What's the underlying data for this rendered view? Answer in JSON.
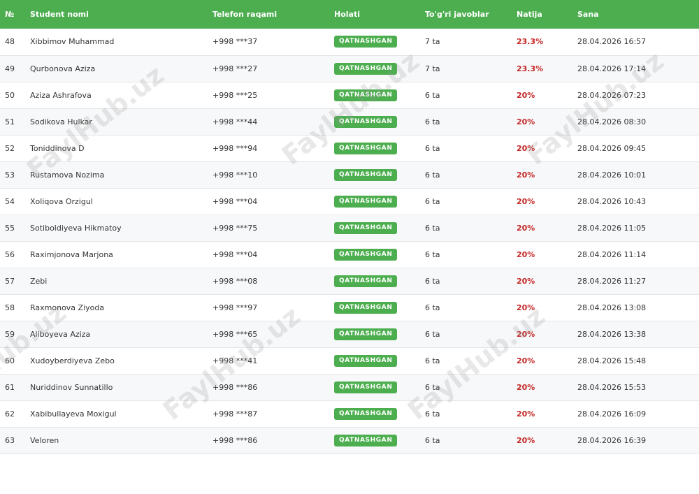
{
  "table": {
    "columns": [
      "№",
      "Student nomi",
      "Telefon raqami",
      "Holati",
      "To'g'ri javoblar",
      "Natija",
      "Sana"
    ],
    "rows": [
      {
        "num": "48",
        "name": "Xibbimov Muhammad",
        "phone": "+998 ***37",
        "status": "QATNASHGAN",
        "correct": "7 ta",
        "result": "23.3%",
        "date": "28.04.2026 16:57"
      },
      {
        "num": "49",
        "name": "Qurbonova Aziza",
        "phone": "+998 ***27",
        "status": "QATNASHGAN",
        "correct": "7 ta",
        "result": "23.3%",
        "date": "28.04.2026 17:14"
      },
      {
        "num": "50",
        "name": "Aziza Ashrafova",
        "phone": "+998 ***25",
        "status": "QATNASHGAN",
        "correct": "6 ta",
        "result": "20%",
        "date": "28.04.2026 07:23"
      },
      {
        "num": "51",
        "name": "Sodikova Hulkar",
        "phone": "+998 ***44",
        "status": "QATNASHGAN",
        "correct": "6 ta",
        "result": "20%",
        "date": "28.04.2026 08:30"
      },
      {
        "num": "52",
        "name": "Toniddinova D",
        "phone": "+998 ***94",
        "status": "QATNASHGAN",
        "correct": "6 ta",
        "result": "20%",
        "date": "28.04.2026 09:45"
      },
      {
        "num": "53",
        "name": "Rustamova Nozima",
        "phone": "+998 ***10",
        "status": "QATNASHGAN",
        "correct": "6 ta",
        "result": "20%",
        "date": "28.04.2026 10:01"
      },
      {
        "num": "54",
        "name": "Xoliqova Orzigul",
        "phone": "+998 ***04",
        "status": "QATNASHGAN",
        "correct": "6 ta",
        "result": "20%",
        "date": "28.04.2026 10:43"
      },
      {
        "num": "55",
        "name": "Sotiboldiyeva Hikmatoy",
        "phone": "+998 ***75",
        "status": "QATNASHGAN",
        "correct": "6 ta",
        "result": "20%",
        "date": "28.04.2026 11:05"
      },
      {
        "num": "56",
        "name": "Raximjonova Marjona",
        "phone": "+998 ***04",
        "status": "QATNASHGAN",
        "correct": "6 ta",
        "result": "20%",
        "date": "28.04.2026 11:14"
      },
      {
        "num": "57",
        "name": "Zebi",
        "phone": "+998 ***08",
        "status": "QATNASHGAN",
        "correct": "6 ta",
        "result": "20%",
        "date": "28.04.2026 11:27"
      },
      {
        "num": "58",
        "name": "Raxmonova Ziyoda",
        "phone": "+998 ***97",
        "status": "QATNASHGAN",
        "correct": "6 ta",
        "result": "20%",
        "date": "28.04.2026 13:08"
      },
      {
        "num": "59",
        "name": "Aliboyeva Aziza",
        "phone": "+998 ***65",
        "status": "QATNASHGAN",
        "correct": "6 ta",
        "result": "20%",
        "date": "28.04.2026 13:38"
      },
      {
        "num": "60",
        "name": "Xudoyberdiyeva Zebo",
        "phone": "+998 ***41",
        "status": "QATNASHGAN",
        "correct": "6 ta",
        "result": "20%",
        "date": "28.04.2026 15:48"
      },
      {
        "num": "61",
        "name": "Nuriddinov Sunnatillo",
        "phone": "+998 ***86",
        "status": "QATNASHGAN",
        "correct": "6 ta",
        "result": "20%",
        "date": "28.04.2026 15:53"
      },
      {
        "num": "62",
        "name": "Xabibullayeva Moxigul",
        "phone": "+998 ***87",
        "status": "QATNASHGAN",
        "correct": "6 ta",
        "result": "20%",
        "date": "28.04.2026 16:09"
      },
      {
        "num": "63",
        "name": "Veloren",
        "phone": "+998 ***86",
        "status": "QATNASHGAN",
        "correct": "6 ta",
        "result": "20%",
        "date": "28.04.2026 16:39"
      }
    ]
  },
  "watermark": "FaylHub.uz",
  "colors": {
    "header_bg": "#4cae4f",
    "badge_bg": "#4cae4f",
    "result_text": "#c62828"
  }
}
